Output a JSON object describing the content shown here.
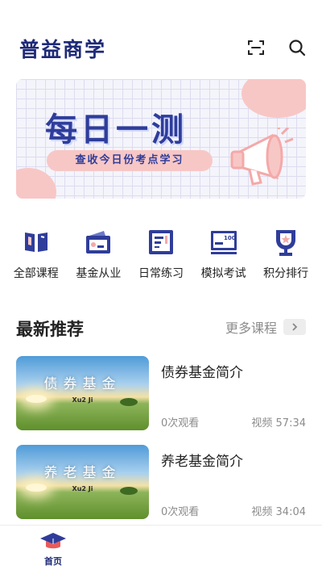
{
  "header": {
    "title": "普益商学",
    "icons": [
      "scan-icon",
      "search-icon"
    ]
  },
  "banner": {
    "title": "每日一测",
    "subtitle": "查收今日份考点学习"
  },
  "quick_nav": [
    {
      "label": "全部课程",
      "icon": "book-icon"
    },
    {
      "label": "基金从业",
      "icon": "wallet-icon"
    },
    {
      "label": "日常练习",
      "icon": "practice-icon"
    },
    {
      "label": "模拟考试",
      "icon": "exam-score-icon"
    },
    {
      "label": "积分排行",
      "icon": "trophy-icon"
    }
  ],
  "section": {
    "title": "最新推荐",
    "more_label": "更多课程"
  },
  "courses": [
    {
      "thumb_title": "债券基金",
      "thumb_sub": "Xu2 Ji",
      "title": "债券基金简介",
      "views": "0次观看",
      "duration": "视频 57:34"
    },
    {
      "thumb_title": "养老基金",
      "thumb_sub": "Xu2 Ji",
      "title": "养老基金简介",
      "views": "0次观看",
      "duration": "视频 34:04"
    }
  ],
  "tabbar": {
    "home_label": "首页"
  },
  "colors": {
    "brand": "#1e2a78",
    "banner_pink": "#f7c7c6",
    "muted": "#8c8c8c"
  }
}
